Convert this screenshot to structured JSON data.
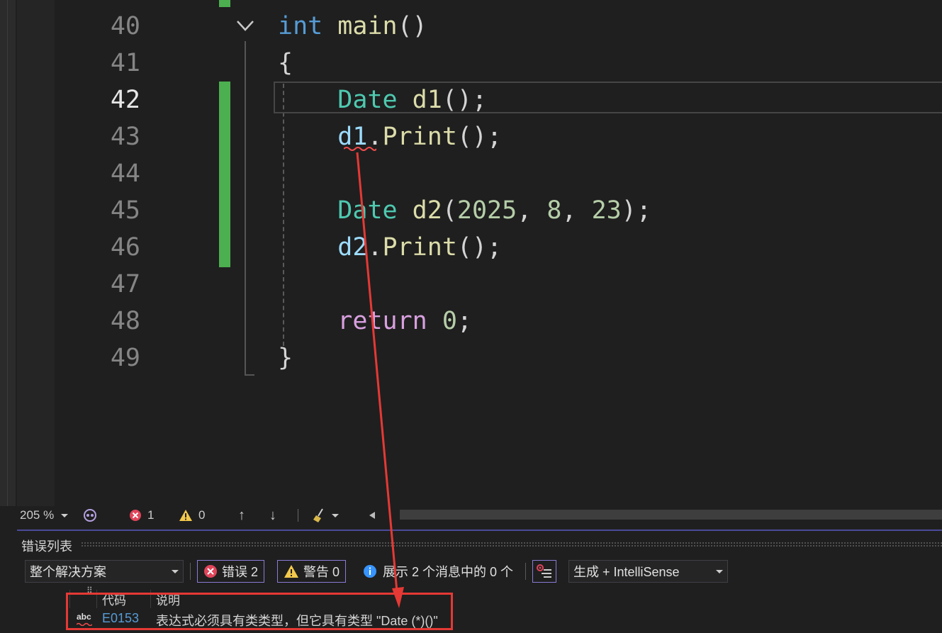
{
  "editor": {
    "line_numbers": [
      "40",
      "41",
      "42",
      "43",
      "44",
      "45",
      "46",
      "47",
      "48",
      "49"
    ],
    "active_line": "42",
    "code": {
      "l40": {
        "kw": "int",
        "fn": "main",
        "pun": "()"
      },
      "l41": {
        "pun": "{"
      },
      "l42": {
        "type": "Date",
        "var": "d1",
        "pun": "();"
      },
      "l43": {
        "var": "d1",
        "dot": ".",
        "fn": "Print",
        "pun": "();"
      },
      "l45": {
        "type": "Date",
        "var": "d2",
        "p1": "(",
        "n1": "2025",
        "c1": ", ",
        "n2": "8",
        "c2": ", ",
        "n3": "23",
        "p2": ");"
      },
      "l46": {
        "var": "d2",
        "dot": ".",
        "fn": "Print",
        "pun": "();"
      },
      "l48": {
        "ctl": "return",
        "num": "0",
        "pun": ";"
      },
      "l49": {
        "pun": "}"
      }
    }
  },
  "statusbar": {
    "zoom": "205 %",
    "errors": "1",
    "warnings": "0",
    "up_arrow": "↑",
    "down_arrow": "↓"
  },
  "error_list": {
    "title": "错误列表",
    "scope": "整个解决方案",
    "errors_label": "错误 2",
    "warnings_label": "警告 0",
    "messages_label": "展示 2 个消息中的 0 个",
    "build_filter": "生成 + IntelliSense",
    "columns": {
      "code": "代码",
      "description": "说明"
    },
    "rows": [
      {
        "code": "E0153",
        "description": "表达式必须具有类类型，但它具有类型 \"Date (*)()\""
      }
    ]
  },
  "colors": {
    "change_bar": "#4caf50",
    "annotation": "#e53935",
    "error": "#e0455a",
    "warning": "#f2c94c",
    "info": "#3794ff"
  }
}
